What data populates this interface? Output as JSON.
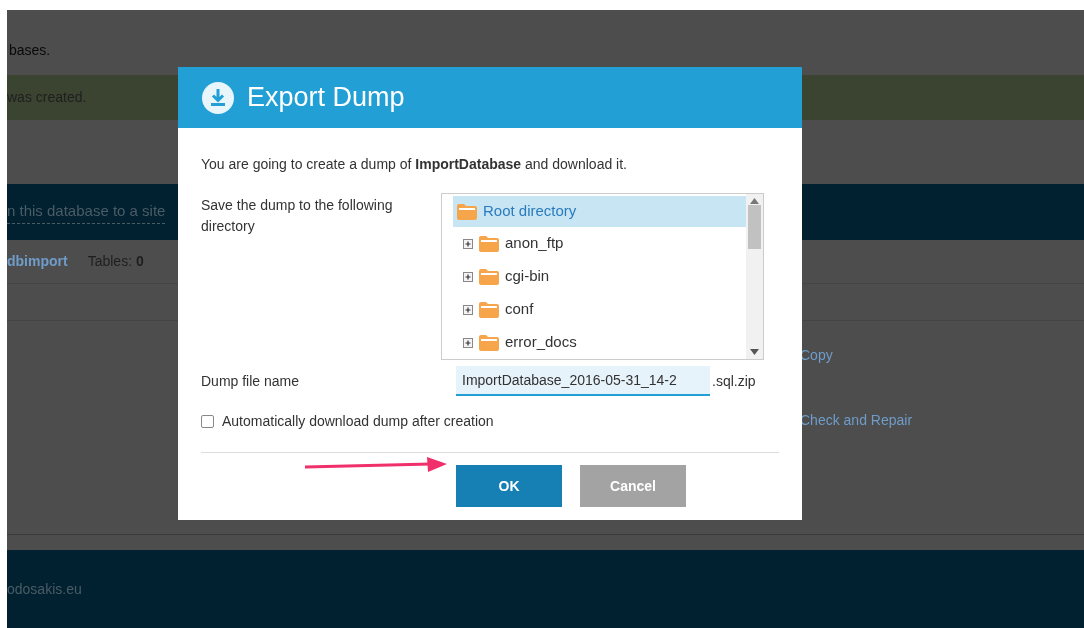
{
  "background": {
    "intro_text": "bases.",
    "success_message": "was created.",
    "assign_link": "n this database to a site",
    "db_link": "dbimport",
    "tables_label": "Tables:",
    "tables_count": "0",
    "actions": [
      "Copy",
      "Check and Repair"
    ],
    "footer_text": "odosakis.eu"
  },
  "dialog": {
    "title": "Export Dump",
    "intro": "You are going to create a dump of **ImportDatabase** and download it.",
    "directory_label": "Save the dump to the following directory",
    "tree": {
      "label": "Root directory",
      "selected": true,
      "children": [
        {
          "label": "anon_ftp",
          "selected": false,
          "expanded": false
        },
        {
          "label": "cgi-bin",
          "selected": false,
          "expanded": false
        },
        {
          "label": "conf",
          "selected": false,
          "expanded": false
        },
        {
          "label": "error_docs",
          "selected": false,
          "expanded": false
        }
      ]
    },
    "filename_label": "Dump file name",
    "filename_value": "ImportDatabase_2016-05-31_14-2",
    "filename_suffix": ".sql.zip",
    "auto_download": {
      "label": "Automatically download dump after creation",
      "checked": false
    },
    "buttons": [
      {
        "label": "OK",
        "kind": "primary"
      },
      {
        "label": "Cancel",
        "kind": "secondary"
      }
    ]
  }
}
